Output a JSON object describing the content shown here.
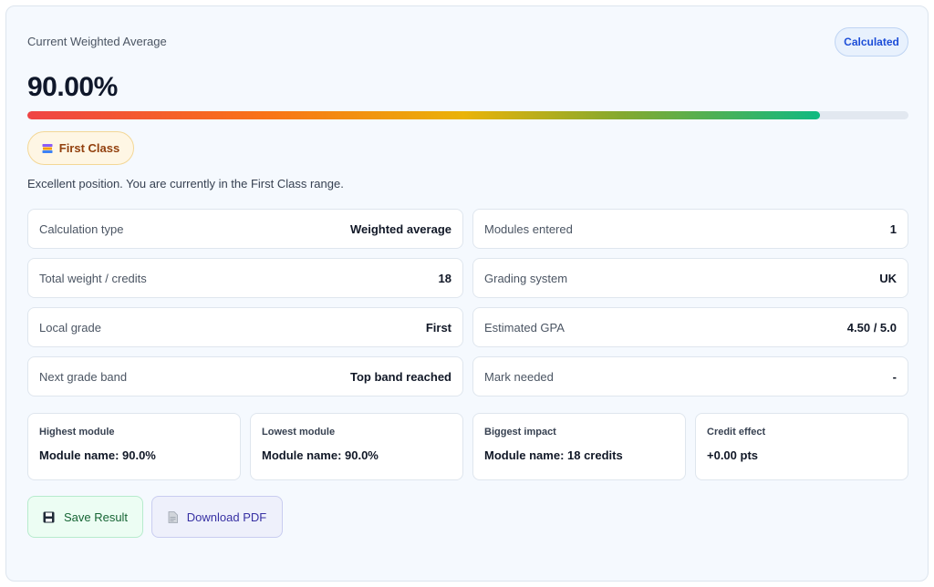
{
  "header": {
    "label": "Current Weighted Average",
    "badge": "Calculated",
    "value": "90.00%",
    "progress_percent": 90
  },
  "classification": {
    "label": "First Class",
    "icon": "books-icon",
    "description": "Excellent position. You are currently in the First Class range."
  },
  "stats": [
    {
      "key": "Calculation type",
      "value": "Weighted average"
    },
    {
      "key": "Modules entered",
      "value": "1"
    },
    {
      "key": "Total weight / credits",
      "value": "18"
    },
    {
      "key": "Grading system",
      "value": "UK"
    },
    {
      "key": "Local grade",
      "value": "First"
    },
    {
      "key": "Estimated GPA",
      "value": "4.50 / 5.0"
    },
    {
      "key": "Next grade band",
      "value": "Top band reached"
    },
    {
      "key": "Mark needed",
      "value": "-"
    }
  ],
  "insights": [
    {
      "title": "Highest module",
      "body": "Module name: 90.0%"
    },
    {
      "title": "Lowest module",
      "body": "Module name: 90.0%"
    },
    {
      "title": "Biggest impact",
      "body": "Module name: 18 credits"
    },
    {
      "title": "Credit effect",
      "body": "+0.00 pts"
    }
  ],
  "actions": {
    "save_label": "Save Result",
    "save_icon": "floppy-disk-icon",
    "pdf_label": "Download PDF",
    "pdf_icon": "document-icon"
  },
  "colors": {
    "accent_blue": "#1d4ed8",
    "first_class": "#92400e",
    "save_green": "#166534",
    "pdf_indigo": "#3730a3"
  }
}
